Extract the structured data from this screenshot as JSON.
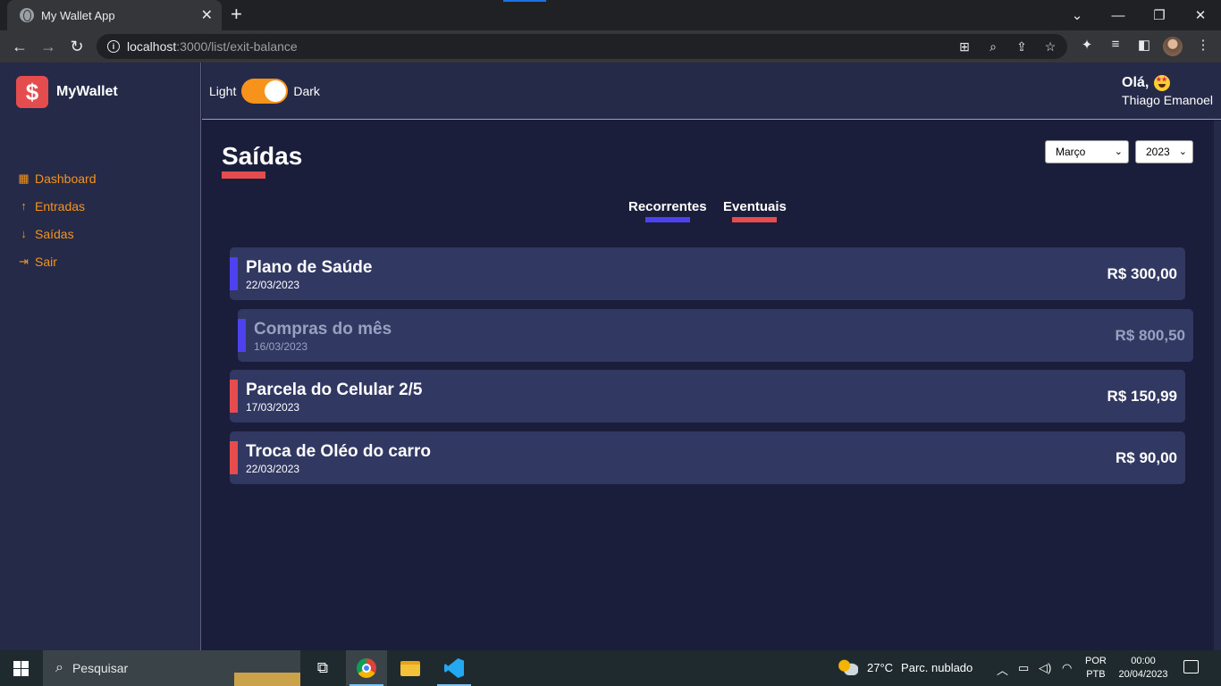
{
  "browser": {
    "tab_title": "My Wallet App",
    "tab_close": "✕",
    "new_tab": "+",
    "url_host": "localhost",
    "url_path": ":3000/list/exit-balance"
  },
  "app": {
    "brand_symbol": "$",
    "brand_name": "MyWallet",
    "menu": [
      {
        "icon": "dashboard-icon",
        "label": "Dashboard"
      },
      {
        "icon": "arrow-up-icon",
        "label": "Entradas"
      },
      {
        "icon": "arrow-down-icon",
        "label": "Saídas"
      },
      {
        "icon": "exit-icon",
        "label": "Sair"
      }
    ],
    "theme": {
      "light_label": "Light",
      "dark_label": "Dark"
    },
    "greeting": "Olá,",
    "user_name": "Thiago Emanoel",
    "page_title": "Saídas",
    "month_select": "Março",
    "year_select": "2023",
    "filters": {
      "recurring": "Recorrentes",
      "eventual": "Eventuais"
    },
    "colors": {
      "accent": "#f7931b",
      "danger": "#e44c4e",
      "recurring": "#4e41f0"
    },
    "transactions": [
      {
        "title": "Plano de Saúde",
        "date": "22/03/2023",
        "amount": "R$ 300,00",
        "frequency": "recorrente"
      },
      {
        "title": "Compras do mês",
        "date": "16/03/2023",
        "amount": "R$ 800,50",
        "frequency": "recorrente"
      },
      {
        "title": "Parcela do Celular 2/5",
        "date": "17/03/2023",
        "amount": "R$ 150,99",
        "frequency": "eventual"
      },
      {
        "title": "Troca de Oléo do carro",
        "date": "22/03/2023",
        "amount": "R$ 90,00",
        "frequency": "eventual"
      }
    ]
  },
  "taskbar": {
    "search_placeholder": "Pesquisar",
    "temperature": "27°C",
    "weather": "Parc. nublado",
    "lang_1": "POR",
    "lang_2": "PTB",
    "time": "00:00",
    "date": "20/04/2023"
  }
}
